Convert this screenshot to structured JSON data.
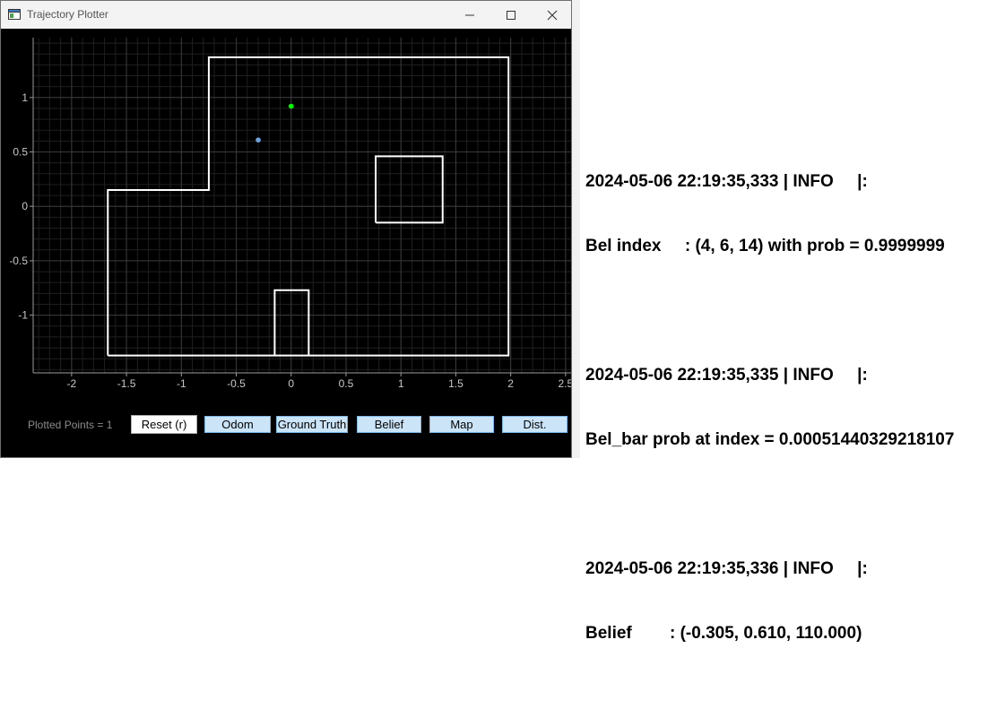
{
  "window": {
    "title": "Trajectory Plotter"
  },
  "plot": {
    "background": "#000000",
    "grid_color": "#3a3a3a",
    "axis_text_color": "#c8c8c8",
    "x_ticks": [
      "-2",
      "-1.5",
      "-1",
      "-0.5",
      "0",
      "0.5",
      "1",
      "1.5",
      "2",
      "2.5"
    ],
    "y_ticks": [
      "1",
      "0.5",
      "0",
      "-0.5",
      "-1"
    ],
    "chart_data": {
      "type": "scatter",
      "xlim": [
        -2.35,
        2.55
      ],
      "ylim": [
        -1.53,
        1.55
      ],
      "grid": true,
      "map_color": "#ffffff",
      "map_outer": [
        [
          -1.67,
          -1.37
        ],
        [
          1.98,
          -1.37
        ],
        [
          1.98,
          1.37
        ],
        [
          -0.75,
          1.37
        ],
        [
          -0.75,
          0.15
        ],
        [
          -1.67,
          0.15
        ],
        [
          -1.67,
          -1.37
        ]
      ],
      "map_box": [
        [
          0.77,
          -0.15
        ],
        [
          1.38,
          -0.15
        ],
        [
          1.38,
          0.46
        ],
        [
          0.77,
          0.46
        ],
        [
          0.77,
          -0.15
        ]
      ],
      "map_notch": [
        [
          -0.15,
          -1.37
        ],
        [
          -0.15,
          -0.77
        ],
        [
          0.16,
          -0.77
        ],
        [
          0.16,
          -1.37
        ]
      ],
      "points": [
        {
          "x": 0.0,
          "y": 0.92,
          "color": "#00ff00"
        },
        {
          "x": -0.3,
          "y": 0.61,
          "color": "#6fa3e0"
        }
      ]
    }
  },
  "controls": {
    "plotted_points": "Plotted Points = 1",
    "buttons": [
      {
        "label": "Reset (r)"
      },
      {
        "label": "Odom"
      },
      {
        "label": "Ground Truth"
      },
      {
        "label": "Belief"
      },
      {
        "label": "Map"
      },
      {
        "label": "Dist."
      }
    ]
  },
  "log": {
    "entries": [
      {
        "header": "2024-05-06 22:19:35,333 | INFO     |:",
        "body": "Bel index     : (4, 6, 14) with prob = 0.9999999"
      },
      {
        "header": "2024-05-06 22:19:35,335 | INFO     |:",
        "body": "Bel_bar prob at index = 0.00051440329218107"
      },
      {
        "header": "2024-05-06 22:19:35,336 | INFO     |:",
        "body": "Belief        : (-0.305, 0.610, 110.000)"
      }
    ]
  }
}
